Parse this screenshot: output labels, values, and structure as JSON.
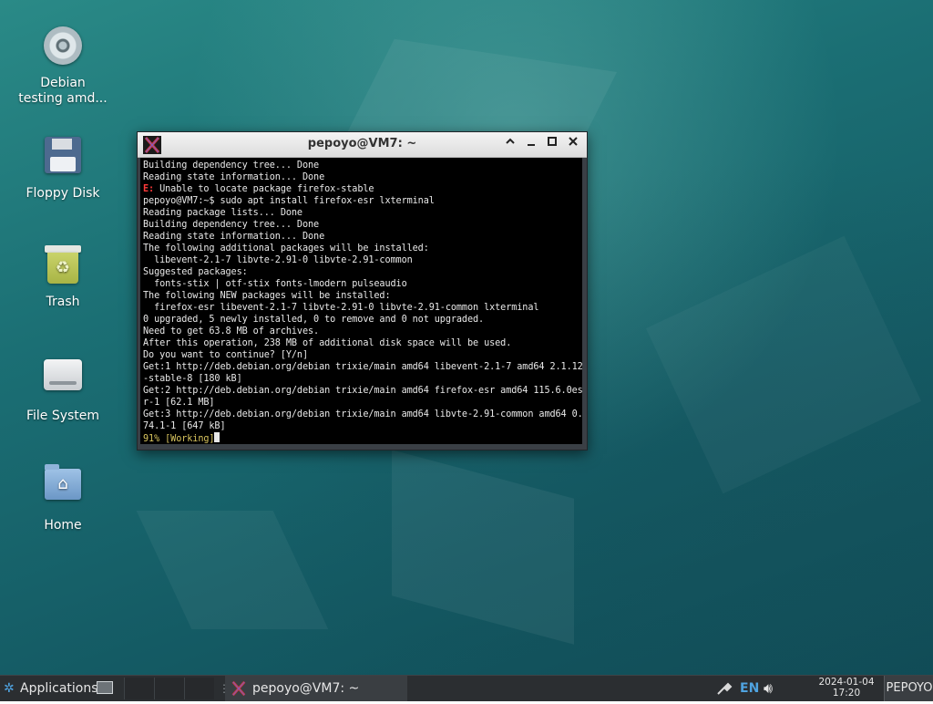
{
  "desktop": {
    "icons": [
      {
        "label": "Debian\ntesting amd...",
        "icon": "cd-icon"
      },
      {
        "label": "Floppy Disk",
        "icon": "floppy-icon"
      },
      {
        "label": "Trash",
        "icon": "trash-icon"
      },
      {
        "label": "File System",
        "icon": "drive-icon"
      },
      {
        "label": "Home",
        "icon": "home-folder-icon"
      }
    ]
  },
  "terminal": {
    "title": "pepoyo@VM7: ~",
    "controls": {
      "shade": "^",
      "minimize": "_",
      "maximize": "□",
      "close": "✕"
    },
    "lines": [
      "Building dependency tree... Done",
      "Reading state information... Done",
      "E: Unable to locate package firefox-stable",
      "pepoyo@VM7:~$ sudo apt install firefox-esr lxterminal",
      "Reading package lists... Done",
      "Building dependency tree... Done",
      "Reading state information... Done",
      "The following additional packages will be installed:",
      "  libevent-2.1-7 libvte-2.91-0 libvte-2.91-common",
      "Suggested packages:",
      "  fonts-stix | otf-stix fonts-lmodern pulseaudio",
      "The following NEW packages will be installed:",
      "  firefox-esr libevent-2.1-7 libvte-2.91-0 libvte-2.91-common lxterminal",
      "0 upgraded, 5 newly installed, 0 to remove and 0 not upgraded.",
      "Need to get 63.8 MB of archives.",
      "After this operation, 238 MB of additional disk space will be used.",
      "Do you want to continue? [Y/n]",
      "Get:1 http://deb.debian.org/debian trixie/main amd64 libevent-2.1-7 amd64 2.1.12",
      "-stable-8 [180 kB]",
      "Get:2 http://deb.debian.org/debian trixie/main amd64 firefox-esr amd64 115.6.0es",
      "r-1 [62.1 MB]",
      "Get:3 http://deb.debian.org/debian trixie/main amd64 libvte-2.91-common amd64 0.",
      "74.1-1 [647 kB]"
    ],
    "error_prefix": "E:",
    "error_rest": " Unable to locate package firefox-stable",
    "progress_line": "91% [Working]"
  },
  "taskbar": {
    "applications_label": "Applications",
    "task_label": "pepoyo@VM7: ~",
    "lang": "EN",
    "date": "2024-01-04",
    "time": "17:20",
    "user": "PEPOYO",
    "colors": {
      "accent": "#4fa3e0",
      "panel": "#2b2e31"
    }
  }
}
